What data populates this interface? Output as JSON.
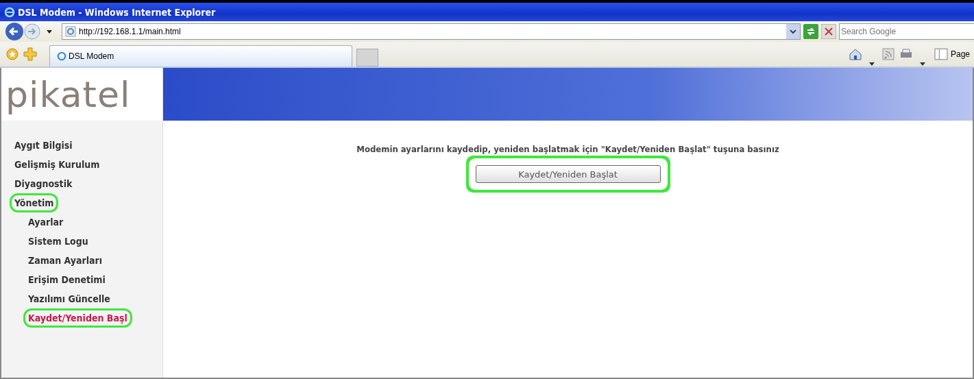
{
  "window": {
    "title": "DSL Modem - Windows Internet Explorer"
  },
  "address_bar": {
    "value": "http://192.168.1.1/main.html"
  },
  "search": {
    "placeholder": "Search Google"
  },
  "tabs": [
    {
      "label": "DSL Modem",
      "selected": true
    }
  ],
  "command_bar": {
    "page_label": "Page"
  },
  "logo": {
    "text": "pikatel"
  },
  "sidebar": {
    "items": [
      {
        "label": "Aygıt Bilgisi",
        "selected": false,
        "highlighted": false
      },
      {
        "label": "Gelişmiş Kurulum",
        "selected": false,
        "highlighted": false
      },
      {
        "label": "Diyagnostik",
        "selected": false,
        "highlighted": false
      },
      {
        "label": "Yönetim",
        "selected": false,
        "highlighted": true,
        "children": [
          {
            "label": "Ayarlar",
            "selected": false,
            "highlighted": false
          },
          {
            "label": "Sistem Logu",
            "selected": false,
            "highlighted": false
          },
          {
            "label": "Zaman Ayarları",
            "selected": false,
            "highlighted": false
          },
          {
            "label": "Erişim Denetimi",
            "selected": false,
            "highlighted": false
          },
          {
            "label": "Yazılımı Güncelle",
            "selected": false,
            "highlighted": false
          },
          {
            "label": "Kaydet/Yeniden Başl",
            "selected": true,
            "highlighted": true
          }
        ]
      }
    ]
  },
  "content": {
    "instruction": "Modemin ayarlarını kaydedip, yeniden başlatmak için \"Kaydet/Yeniden Başlat\" tuşuna basınız",
    "button": {
      "label": "Kaydet/Yeniden Başlat",
      "highlighted": true
    }
  }
}
